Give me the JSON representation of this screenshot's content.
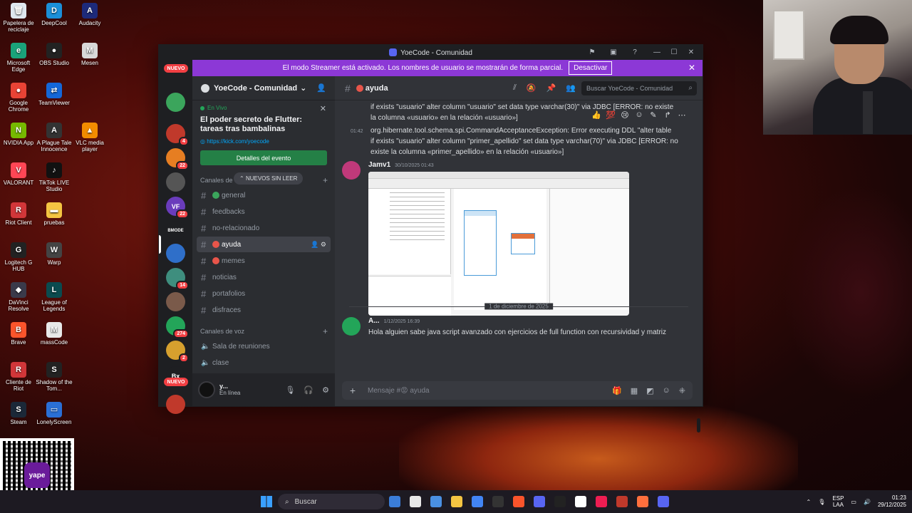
{
  "desktop": {
    "icons": [
      {
        "label": "Papelera de reciclaje",
        "color": "#dfe7ef",
        "glyph": "🗑"
      },
      {
        "label": "DeepCool",
        "color": "#1b8fd8",
        "glyph": "D"
      },
      {
        "label": "Audacity",
        "color": "#1d2a7a",
        "glyph": "A"
      },
      {
        "label": "Microsoft Edge",
        "color": "#1aa37a",
        "glyph": "e"
      },
      {
        "label": "OBS Studio",
        "color": "#222",
        "glyph": "●"
      },
      {
        "label": "Mesen",
        "color": "#d8d8d8",
        "glyph": "M"
      },
      {
        "label": "Google Chrome",
        "color": "#e84335",
        "glyph": "●"
      },
      {
        "label": "TeamViewer",
        "color": "#1467d8",
        "glyph": "⇄"
      },
      {
        "label": "NVIDIA App",
        "color": "#76b900",
        "glyph": "N"
      },
      {
        "label": "A Plague Tale Innocence",
        "color": "#333",
        "glyph": "A"
      },
      {
        "label": "VLC media player",
        "color": "#f28c00",
        "glyph": "▲"
      },
      {
        "label": "VALORANT",
        "color": "#ff4655",
        "glyph": "V"
      },
      {
        "label": "TikTok LIVE Studio",
        "color": "#111",
        "glyph": "♪"
      },
      {
        "label": "Riot Client",
        "color": "#d13639",
        "glyph": "R"
      },
      {
        "label": "pruebas",
        "color": "#f4c542",
        "glyph": "▬"
      },
      {
        "label": "Logitech G HUB",
        "color": "#222",
        "glyph": "G"
      },
      {
        "label": "Warp",
        "color": "#444",
        "glyph": "W"
      },
      {
        "label": "DaVinci Resolve",
        "color": "#3a3a4a",
        "glyph": "◆"
      },
      {
        "label": "League of Legends",
        "color": "#0a4b4f",
        "glyph": "L"
      },
      {
        "label": "Brave",
        "color": "#fb542b",
        "glyph": "B"
      },
      {
        "label": "massCode",
        "color": "#e8e8e8",
        "glyph": "M"
      },
      {
        "label": "Cliente de Riot",
        "color": "#d13639",
        "glyph": "R"
      },
      {
        "label": "Shadow of the Tom...",
        "color": "#222",
        "glyph": "S"
      },
      {
        "label": "Steam",
        "color": "#1b2838",
        "glyph": "S"
      },
      {
        "label": "LonelyScreen",
        "color": "#2a6fd6",
        "glyph": "▭"
      }
    ],
    "qr_brand": "yape"
  },
  "window": {
    "title": "YoeCode - Comunidad",
    "controls": [
      "—",
      "☐",
      "✕"
    ],
    "tools": [
      "inbox-icon",
      "screen-icon",
      "help-icon"
    ]
  },
  "streamer": {
    "message": "El modo Streamer está activado. Los nombres de usuario se mostrarán de forma parcial.",
    "button": "Desactivar"
  },
  "guilds": [
    {
      "label": "",
      "color": "#3ba55c",
      "badge": ""
    },
    {
      "label": "",
      "color": "#c0392b",
      "badge": "4"
    },
    {
      "label": "",
      "color": "#e67e22",
      "badge": "22"
    },
    {
      "label": "",
      "color": "#555",
      "badge": ""
    },
    {
      "label": "VF",
      "color": "#6a3cbc",
      "badge": "22"
    },
    {
      "label": "BMODE",
      "color": "#1e1f22",
      "badge": ""
    },
    {
      "label": "",
      "color": "#2f6fc9",
      "badge": ""
    },
    {
      "label": "",
      "color": "#3e8e7e",
      "badge": "14"
    },
    {
      "label": "",
      "color": "#7a5a4a",
      "badge": ""
    },
    {
      "label": "",
      "color": "#23a559",
      "badge": "274"
    },
    {
      "label": "",
      "color": "#d6a02e",
      "badge": "2"
    },
    {
      "label": "Bx",
      "color": "#1e1f22",
      "badge": ""
    },
    {
      "label": "",
      "color": "#c0392b",
      "badge": ""
    }
  ],
  "guild_new_label": "NUEVO",
  "server": {
    "name": "YoeCode - Comunidad",
    "event": {
      "status": "En Vivo",
      "title": "El poder secreto de Flutter: tareas tras bambalinas",
      "link": "https://kick.com/yoecode",
      "button": "Detalles del evento"
    },
    "text_category": "Canales de",
    "unread_pill": "NUEVOS SIN LEER",
    "channels": [
      {
        "name": "general",
        "type": "globe"
      },
      {
        "name": "feedbacks",
        "type": "text"
      },
      {
        "name": "no-relacionado",
        "type": "text"
      },
      {
        "name": "ayuda",
        "type": "emoji",
        "selected": true
      },
      {
        "name": "memes",
        "type": "emoji"
      },
      {
        "name": "noticias",
        "type": "text"
      },
      {
        "name": "portafolios",
        "type": "text"
      },
      {
        "name": "disfraces",
        "type": "text"
      }
    ],
    "voice_category": "Canales de voz",
    "voice_channels": [
      "Sala de reuniones",
      "clase"
    ]
  },
  "user": {
    "name": "y...",
    "status": "En línea"
  },
  "channel_header": {
    "name": "ayuda",
    "search_placeholder": "Buscar YoeCode - Comunidad"
  },
  "messages": {
    "line1a": "if exists \"usuario\" alter column \"usuario\" set data type varchar(30)\" via JDBC [ERROR: no existe",
    "line1b": "la columna «usuario» en la relación «usuario»]",
    "ts2": "01:42",
    "line2a": "org.hibernate.tool.schema.spi.CommandAcceptanceException: Error executing DDL \"alter table",
    "line2b": "if exists \"usuario\" alter column \"primer_apellido\" set data type varchar(70)\" via JDBC [ERROR: no",
    "line2c": "existe la columna «primer_apellido» en la relación «usuario»]",
    "msg3_author": "Jamv1",
    "msg3_time": "30/10/2025 01:43",
    "date_separator": "1 de diciembre de 2025",
    "msg4_author": "A...",
    "msg4_time": "1/12/2025 16:39",
    "msg4_body": "Hola alguien sabe java script avanzado con ejercicios de full function con recursividad y matriz"
  },
  "composer": {
    "placeholder": "Mensaje #😡 ayuda"
  },
  "taskbar": {
    "search": "Buscar",
    "lang1": "ESP",
    "lang2": "LAA",
    "time": "01:23",
    "date": "29/12/2025",
    "apps": [
      "#3b7dd8",
      "#e8e8e8",
      "#4a90e2",
      "#f4c542",
      "#4285f4",
      "#333",
      "#fb542b",
      "#5865f2",
      "#222",
      "#fff",
      "#ee1d52",
      "#c0392b",
      "#ff6f3d",
      "#5865f2"
    ]
  }
}
